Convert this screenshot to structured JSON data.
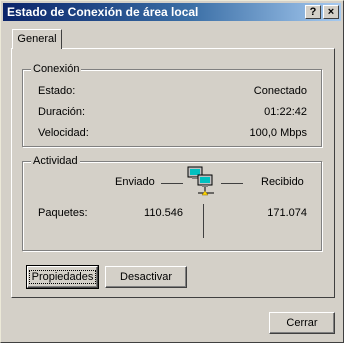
{
  "window": {
    "title": "Estado de Conexión de área local",
    "help_glyph": "?",
    "close_glyph": "×"
  },
  "tabs": [
    {
      "label": "General"
    }
  ],
  "connection": {
    "legend": "Conexión",
    "rows": [
      {
        "label": "Estado:",
        "value": "Conectado"
      },
      {
        "label": "Duración:",
        "value": "01:22:42"
      },
      {
        "label": "Velocidad:",
        "value": "100,0 Mbps"
      }
    ]
  },
  "activity": {
    "legend": "Actividad",
    "sent_label": "Enviado",
    "received_label": "Recibido",
    "packets_label": "Paquetes:",
    "packets_sent": "110.546",
    "packets_received": "171.074"
  },
  "buttons": {
    "properties": "Propiedades",
    "disable": "Desactivar",
    "close": "Cerrar"
  },
  "colors": {
    "title_start": "#0a246a",
    "title_end": "#a6caf0",
    "face": "#d4d0c8"
  },
  "icons": {
    "network_activity": "network-computers-icon"
  }
}
